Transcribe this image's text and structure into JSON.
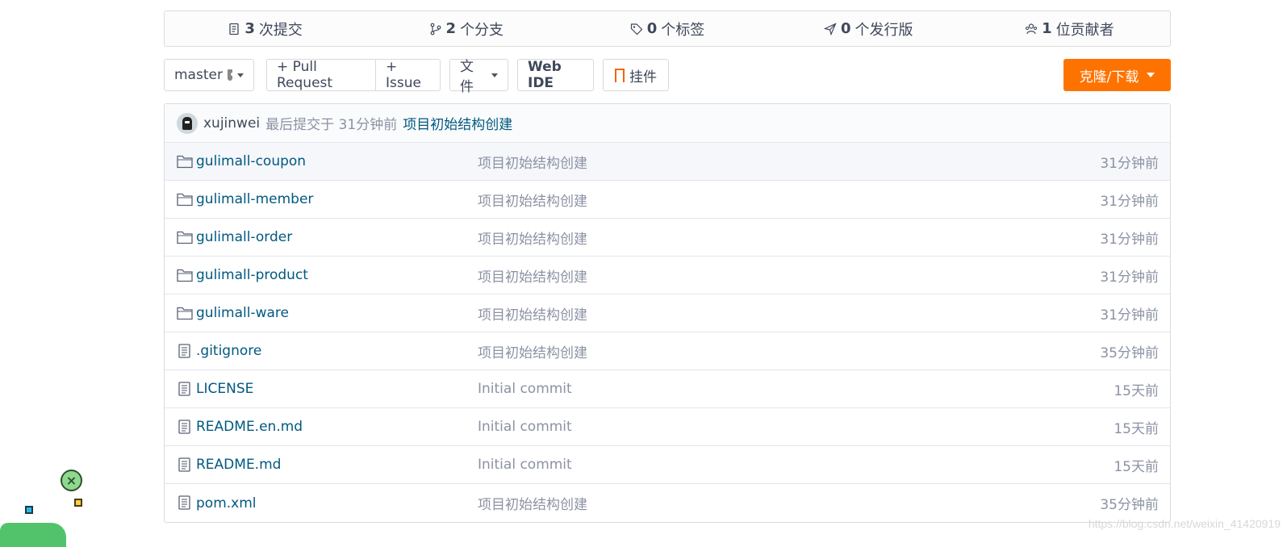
{
  "stats": [
    {
      "count": "3",
      "label": "次提交",
      "icon": "commit-icon"
    },
    {
      "count": "2",
      "label": "个分支",
      "icon": "branch-icon"
    },
    {
      "count": "0",
      "label": "个标签",
      "icon": "tag-icon"
    },
    {
      "count": "0",
      "label": "个发行版",
      "icon": "release-icon"
    },
    {
      "count": "1",
      "label": "位贡献者",
      "icon": "contributors-icon"
    }
  ],
  "toolbar": {
    "branch": "master",
    "pull_request": "+ Pull Request",
    "issue": "+ Issue",
    "file": "文件",
    "web_ide": "Web IDE",
    "widget": "挂件",
    "clone": "克隆/下载"
  },
  "last_commit": {
    "author": "xujinwei",
    "meta": "最后提交于 31分钟前",
    "message": "项目初始结构创建"
  },
  "files": [
    {
      "type": "folder",
      "name": "gulimall-coupon",
      "message": "项目初始结构创建",
      "time": "31分钟前"
    },
    {
      "type": "folder",
      "name": "gulimall-member",
      "message": "项目初始结构创建",
      "time": "31分钟前"
    },
    {
      "type": "folder",
      "name": "gulimall-order",
      "message": "项目初始结构创建",
      "time": "31分钟前"
    },
    {
      "type": "folder",
      "name": "gulimall-product",
      "message": "项目初始结构创建",
      "time": "31分钟前"
    },
    {
      "type": "folder",
      "name": "gulimall-ware",
      "message": "项目初始结构创建",
      "time": "31分钟前"
    },
    {
      "type": "file",
      "name": ".gitignore",
      "message": "项目初始结构创建",
      "time": "35分钟前"
    },
    {
      "type": "file",
      "name": "LICENSE",
      "message": "Initial commit",
      "time": "15天前"
    },
    {
      "type": "file",
      "name": "README.en.md",
      "message": "Initial commit",
      "time": "15天前"
    },
    {
      "type": "file",
      "name": "README.md",
      "message": "Initial commit",
      "time": "15天前"
    },
    {
      "type": "file",
      "name": "pom.xml",
      "message": "项目初始结构创建",
      "time": "35分钟前"
    }
  ],
  "watermark": "https://blog.csdn.net/weixin_41420919",
  "colors": {
    "accent": "#fe7300",
    "link": "#005980",
    "muted": "#8c92a4"
  }
}
